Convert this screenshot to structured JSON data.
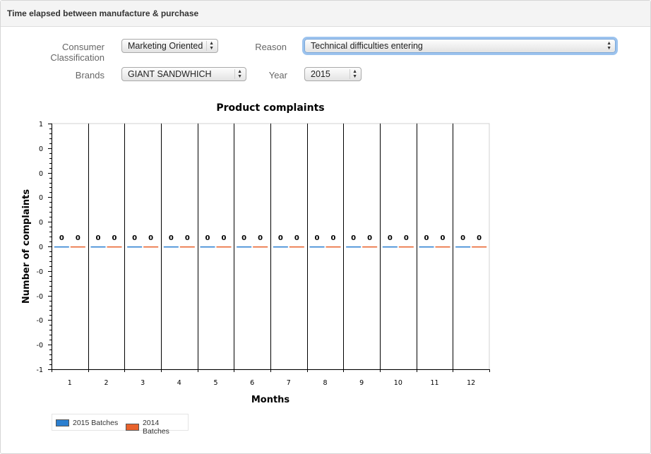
{
  "panel": {
    "title": "Time elapsed between manufacture & purchase"
  },
  "filters": {
    "consumer_classification": {
      "label": "Consumer Classification",
      "value": "Marketing Oriented"
    },
    "reason": {
      "label": "Reason",
      "value": "Technical difficulties entering"
    },
    "brands": {
      "label": "Brands",
      "value": "GIANT SANDWHICH"
    },
    "year": {
      "label": "Year",
      "value": "2015"
    }
  },
  "colors": {
    "series_2015": "#2b7fd0",
    "series_2014": "#e8622c"
  },
  "chart_data": {
    "type": "bar",
    "title": "Product complaints",
    "xlabel": "Months",
    "ylabel": "Number of complaints",
    "categories": [
      "1",
      "2",
      "3",
      "4",
      "5",
      "6",
      "7",
      "8",
      "9",
      "10",
      "11",
      "12"
    ],
    "y_tick_labels": [
      "1",
      "0",
      "0",
      "0",
      "0",
      "0",
      "-0",
      "-0",
      "-0",
      "-0",
      "-1"
    ],
    "ylim": [
      -1,
      1
    ],
    "grid": "vertical",
    "legend_position": "bottom-left",
    "series": [
      {
        "name": "2015 Batches",
        "values": [
          0,
          0,
          0,
          0,
          0,
          0,
          0,
          0,
          0,
          0,
          0,
          0
        ]
      },
      {
        "name": "2014 Batches",
        "values": [
          0,
          0,
          0,
          0,
          0,
          0,
          0,
          0,
          0,
          0,
          0,
          0
        ]
      }
    ]
  }
}
